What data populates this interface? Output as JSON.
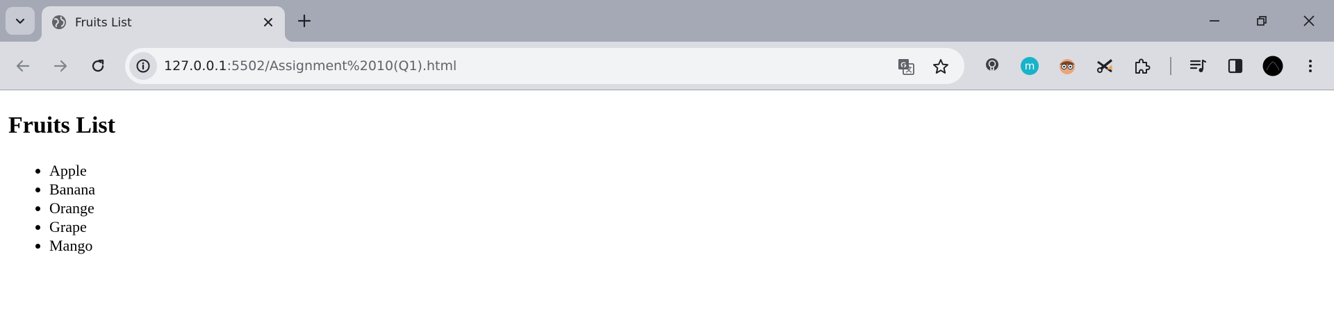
{
  "tab": {
    "title": "Fruits List",
    "favicon": "globe-icon"
  },
  "omnibox": {
    "host": "127.0.0.1",
    "path": ":5502/Assignment%2010(Q1).html"
  },
  "extensions": [
    "lightbulb-extension-icon",
    "m-extension-icon",
    "face-extension-icon",
    "scissors-extension-icon",
    "puzzle-extensions-icon"
  ],
  "page": {
    "heading": "Fruits List",
    "fruits": [
      "Apple",
      "Banana",
      "Orange",
      "Grape",
      "Mango"
    ]
  },
  "colors": {
    "tabstrip": "#a5a9b6",
    "toolbar": "#dadce2",
    "omnibox": "#f2f3f5",
    "m_extension": "#17b3c9"
  }
}
